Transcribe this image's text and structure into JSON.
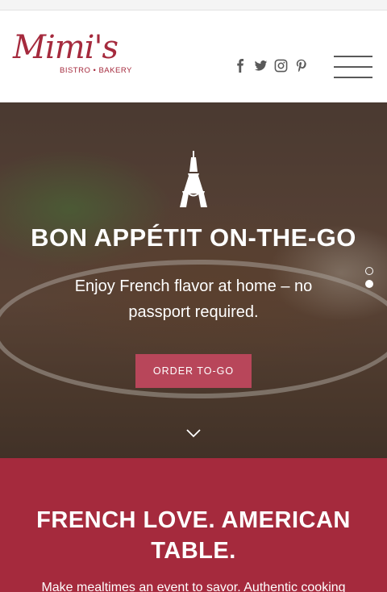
{
  "header": {
    "logo_script": "Mimi's",
    "logo_sub": "BISTRO • BAKERY",
    "social_icons": [
      "facebook-icon",
      "twitter-icon",
      "instagram-icon",
      "pinterest-icon"
    ],
    "menu_icon": "hamburger-menu-icon"
  },
  "hero": {
    "title": "BON APPÉTIT ON-THE-GO",
    "subtitle": "Enjoy French flavor at home – no passport required.",
    "cta_label": "ORDER TO-GO",
    "slides": [
      {
        "active": false
      },
      {
        "active": true
      }
    ]
  },
  "section": {
    "title": "FRENCH LOVE. AMERICAN TABLE.",
    "text": "Make mealtimes an event to savor. Authentic cooking"
  },
  "colors": {
    "brand": "#a52a3d",
    "button": "#b8465a",
    "icon_gray": "#595959"
  }
}
